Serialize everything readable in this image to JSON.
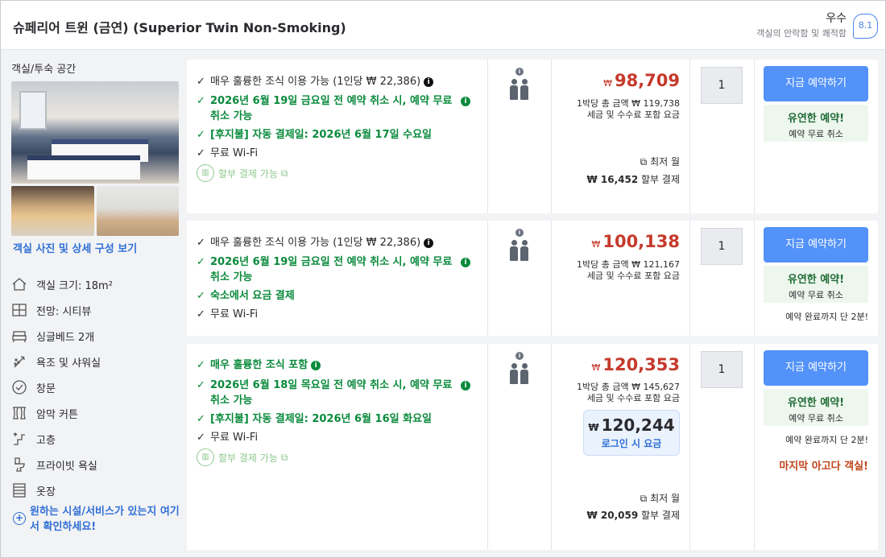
{
  "header": {
    "title": "슈페리어 트윈 (금연) (Superior Twin Non-Smoking)",
    "rating_word": "우수",
    "rating_sub": "객실의 안락함 및 쾌적함",
    "rating_score": "8.1"
  },
  "left": {
    "space_label": "객실/투숙 공간",
    "photo_link": "객실 사진 및 상세 구성 보기",
    "features": [
      {
        "icon": "house-icon",
        "label": "객실 크기: 18m²"
      },
      {
        "icon": "window-view-icon",
        "label": "전망: 시티뷰"
      },
      {
        "icon": "bed-icon",
        "label": "싱글베드 2개"
      },
      {
        "icon": "shower-icon",
        "label": "욕조 및 샤워실"
      },
      {
        "icon": "checkmark-circle-icon",
        "label": "창문"
      },
      {
        "icon": "curtain-icon",
        "label": "암막 커튼"
      },
      {
        "icon": "elevator-icon",
        "label": "고층"
      },
      {
        "icon": "toilet-icon",
        "label": "프라이빗 욕실"
      },
      {
        "icon": "wardrobe-icon",
        "label": "옷장"
      }
    ],
    "more_link": "원하는 시설/서비스가 있는지 여기서 확인하세요!"
  },
  "rows": [
    {
      "benefits": [
        {
          "style": "black",
          "mark": "✓",
          "text": "매우 훌륭한 조식 이용 가능 (1인당 ₩ 22,386)",
          "info": true
        },
        {
          "style": "green",
          "mark": "✓",
          "text": "2026년 6월 19일 금요일 전 예약 취소 시, 예약 무료 취소 가능",
          "info": true
        },
        {
          "style": "green",
          "mark": "✓",
          "text": "[후지불] 자동 결제일: 2026년 6월 17일 수요일",
          "info": false
        },
        {
          "style": "black",
          "mark": "✓",
          "text": "무료 Wi-Fi",
          "info": false
        }
      ],
      "installment": "할부 결제 가능",
      "currency": "₩",
      "price": "98,709",
      "total_line": "1박당 총 금액 ₩ 119,738",
      "tax_line": "세금 및 수수료 포함 요금",
      "monthly_label": "최저 월",
      "monthly_amount": "₩ 16,452",
      "monthly_suffix": "할부 결제",
      "qty": "1",
      "book_label": "지금 예약하기",
      "flex_title": "유연한 예약!",
      "flex_sub": "예약 무료 취소"
    },
    {
      "benefits": [
        {
          "style": "black",
          "mark": "✓",
          "text": "매우 훌륭한 조식 이용 가능 (1인당 ₩ 22,386)",
          "info": true
        },
        {
          "style": "green",
          "mark": "✓",
          "text": "2026년 6월 19일 금요일 전 예약 취소 시, 예약 무료 취소 가능",
          "info": true
        },
        {
          "style": "green",
          "mark": "✓",
          "text": "숙소에서 요금 결제",
          "info": false
        },
        {
          "style": "black",
          "mark": "✓",
          "text": "무료 Wi-Fi",
          "info": false
        }
      ],
      "currency": "₩",
      "price": "100,138",
      "total_line": "1박당 총 금액 ₩ 121,167",
      "tax_line": "세금 및 수수료 포함 요금",
      "qty": "1",
      "book_label": "지금 예약하기",
      "flex_title": "유연한 예약!",
      "flex_sub": "예약 무료 취소",
      "two_min": "예약 완료까지 단 2분!"
    },
    {
      "benefits": [
        {
          "style": "green",
          "mark": "✓",
          "text": "매우 훌륭한 조식 포함",
          "info": true
        },
        {
          "style": "green",
          "mark": "✓",
          "text": "2026년 6월 18일 목요일 전 예약 취소 시, 예약 무료 취소 가능",
          "info": true
        },
        {
          "style": "green",
          "mark": "✓",
          "text": "[후지불] 자동 결제일: 2026년 6월 16일 화요일",
          "info": false
        },
        {
          "style": "black",
          "mark": "✓",
          "text": "무료 Wi-Fi",
          "info": false
        }
      ],
      "installment": "할부 결제 가능",
      "currency": "₩",
      "price": "120,353",
      "total_line": "1박당 총 금액 ₩ 145,627",
      "tax_line": "세금 및 수수료 포함 요금",
      "login_price": "120,244",
      "login_label": "로그인 시 요금",
      "monthly_label": "최저 월",
      "monthly_amount": "₩ 20,059",
      "monthly_suffix": "할부 결제",
      "qty": "1",
      "book_label": "지금 예약하기",
      "flex_title": "유연한 예약!",
      "flex_sub": "예약 무료 취소",
      "two_min": "예약 완료까지 단 2분!",
      "last_room": "마지막 아고다 객실!"
    }
  ],
  "colors": {
    "accent_blue": "#5392f9",
    "price_red": "#c53a2c",
    "benefit_green": "#0a8a3c",
    "urgency_orange": "#c0441a"
  }
}
